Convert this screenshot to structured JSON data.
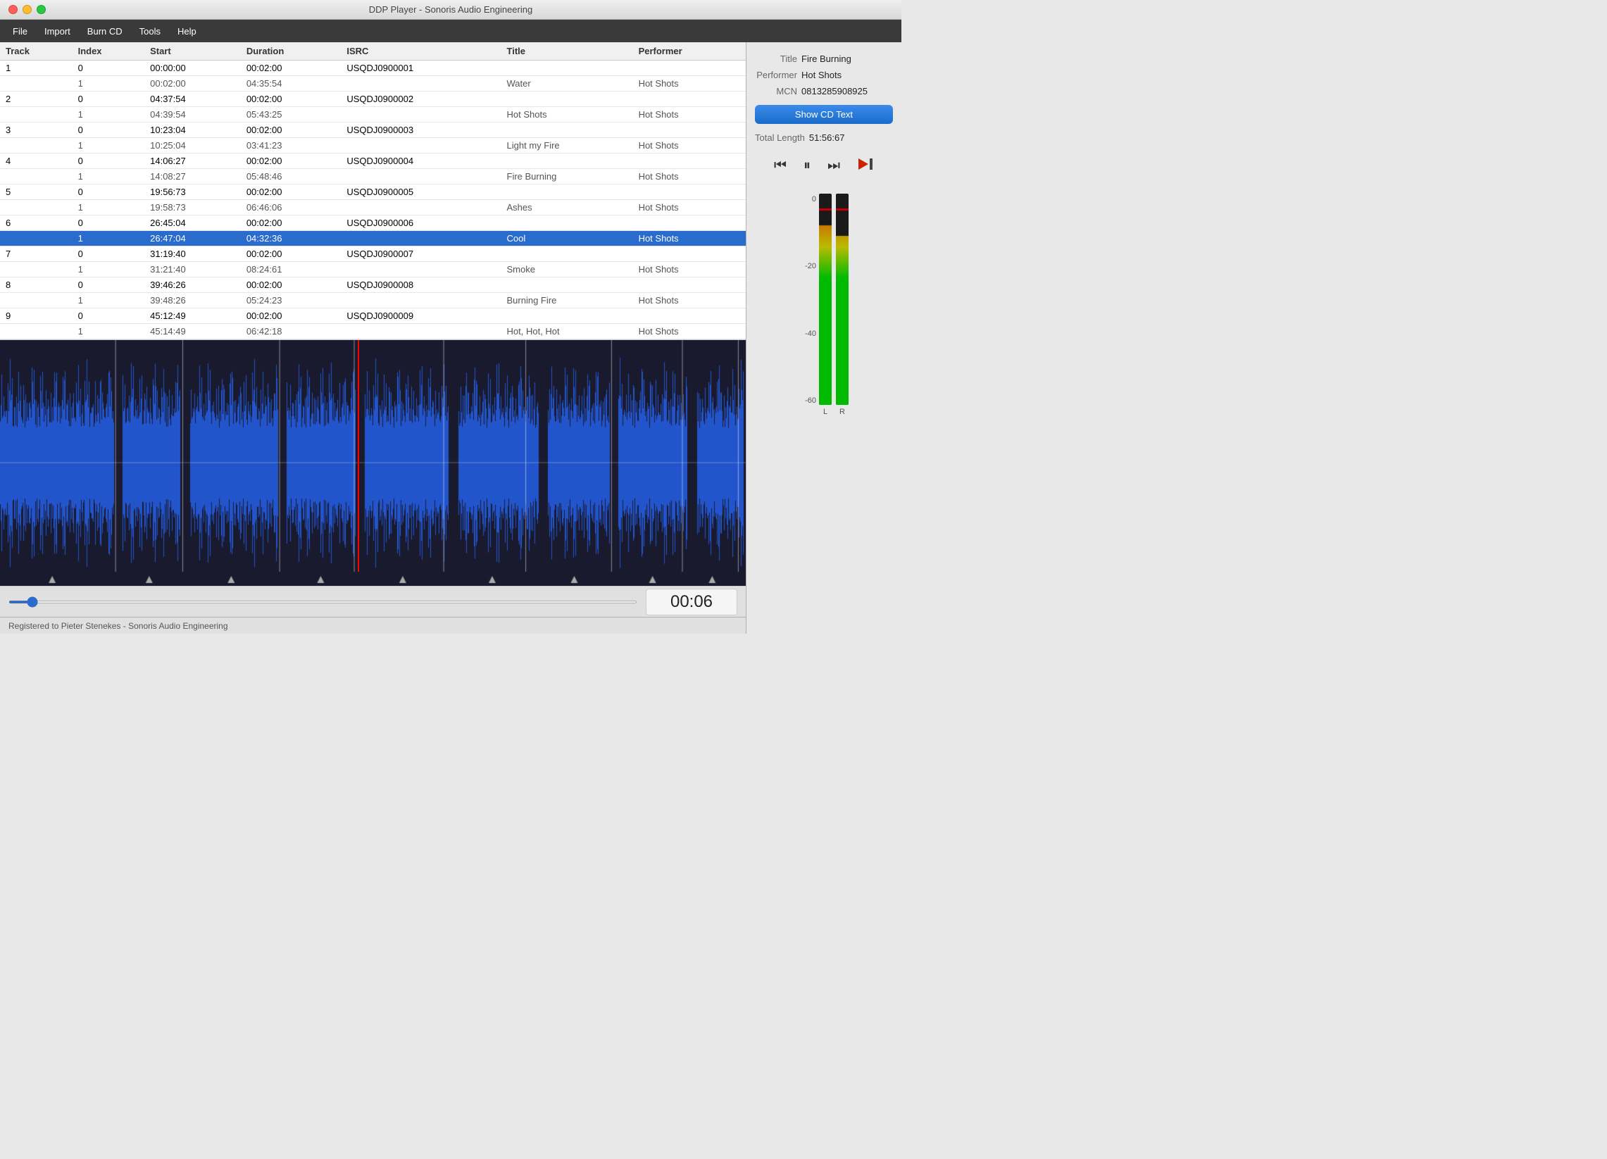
{
  "window": {
    "title": "DDP Player - Sonoris Audio Engineering"
  },
  "menu": {
    "items": [
      "File",
      "Import",
      "Burn CD",
      "Tools",
      "Help"
    ]
  },
  "table": {
    "columns": [
      "Track",
      "Index",
      "Start",
      "Duration",
      "ISRC",
      "Title",
      "Performer"
    ],
    "rows": [
      {
        "track": "1",
        "index": "0",
        "start": "00:00:00",
        "duration": "00:02:00",
        "isrc": "USQDJ0900001",
        "title": "",
        "performer": "",
        "selected": false,
        "isTrack": true
      },
      {
        "track": "",
        "index": "1",
        "start": "00:02:00",
        "duration": "04:35:54",
        "isrc": "",
        "title": "Water",
        "performer": "Hot Shots",
        "selected": false,
        "isTrack": false
      },
      {
        "track": "2",
        "index": "0",
        "start": "04:37:54",
        "duration": "00:02:00",
        "isrc": "USQDJ0900002",
        "title": "",
        "performer": "",
        "selected": false,
        "isTrack": true
      },
      {
        "track": "",
        "index": "1",
        "start": "04:39:54",
        "duration": "05:43:25",
        "isrc": "",
        "title": "Hot Shots",
        "performer": "Hot Shots",
        "selected": false,
        "isTrack": false
      },
      {
        "track": "3",
        "index": "0",
        "start": "10:23:04",
        "duration": "00:02:00",
        "isrc": "USQDJ0900003",
        "title": "",
        "performer": "",
        "selected": false,
        "isTrack": true
      },
      {
        "track": "",
        "index": "1",
        "start": "10:25:04",
        "duration": "03:41:23",
        "isrc": "",
        "title": "Light my Fire",
        "performer": "Hot Shots",
        "selected": false,
        "isTrack": false
      },
      {
        "track": "4",
        "index": "0",
        "start": "14:06:27",
        "duration": "00:02:00",
        "isrc": "USQDJ0900004",
        "title": "",
        "performer": "",
        "selected": false,
        "isTrack": true
      },
      {
        "track": "",
        "index": "1",
        "start": "14:08:27",
        "duration": "05:48:46",
        "isrc": "",
        "title": "Fire Burning",
        "performer": "Hot Shots",
        "selected": false,
        "isTrack": false
      },
      {
        "track": "5",
        "index": "0",
        "start": "19:56:73",
        "duration": "00:02:00",
        "isrc": "USQDJ0900005",
        "title": "",
        "performer": "",
        "selected": false,
        "isTrack": true
      },
      {
        "track": "",
        "index": "1",
        "start": "19:58:73",
        "duration": "06:46:06",
        "isrc": "",
        "title": "Ashes",
        "performer": "Hot Shots",
        "selected": false,
        "isTrack": false
      },
      {
        "track": "6",
        "index": "0",
        "start": "26:45:04",
        "duration": "00:02:00",
        "isrc": "USQDJ0900006",
        "title": "",
        "performer": "",
        "selected": false,
        "isTrack": true
      },
      {
        "track": "",
        "index": "1",
        "start": "26:47:04",
        "duration": "04:32:36",
        "isrc": "",
        "title": "Cool",
        "performer": "Hot Shots",
        "selected": true,
        "isTrack": false
      },
      {
        "track": "7",
        "index": "0",
        "start": "31:19:40",
        "duration": "00:02:00",
        "isrc": "USQDJ0900007",
        "title": "",
        "performer": "",
        "selected": false,
        "isTrack": true
      },
      {
        "track": "",
        "index": "1",
        "start": "31:21:40",
        "duration": "08:24:61",
        "isrc": "",
        "title": "Smoke",
        "performer": "Hot Shots",
        "selected": false,
        "isTrack": false
      },
      {
        "track": "8",
        "index": "0",
        "start": "39:46:26",
        "duration": "00:02:00",
        "isrc": "USQDJ0900008",
        "title": "",
        "performer": "",
        "selected": false,
        "isTrack": true
      },
      {
        "track": "",
        "index": "1",
        "start": "39:48:26",
        "duration": "05:24:23",
        "isrc": "",
        "title": "Burning Fire",
        "performer": "Hot Shots",
        "selected": false,
        "isTrack": false
      },
      {
        "track": "9",
        "index": "0",
        "start": "45:12:49",
        "duration": "00:02:00",
        "isrc": "USQDJ0900009",
        "title": "",
        "performer": "",
        "selected": false,
        "isTrack": true
      },
      {
        "track": "",
        "index": "1",
        "start": "45:14:49",
        "duration": "06:42:18",
        "isrc": "",
        "title": "Hot, Hot, Hot",
        "performer": "Hot Shots",
        "selected": false,
        "isTrack": false
      }
    ]
  },
  "info_panel": {
    "title_label": "Title",
    "title_value": "Fire Burning",
    "performer_label": "Performer",
    "performer_value": "Hot Shots",
    "mcn_label": "MCN",
    "mcn_value": "0813285908925",
    "show_cd_text_btn": "Show CD Text",
    "total_length_label": "Total Length",
    "total_length_value": "51:56:67"
  },
  "transport": {
    "rewind_icon": "⏮",
    "pause_icon": "⏸",
    "forward_icon": "⏭",
    "play_to_end_icon": "▶|"
  },
  "vu_meter": {
    "scale_labels": [
      "0",
      "-20",
      "-40",
      "-60"
    ],
    "channel_labels": [
      "L",
      "R"
    ],
    "left_level": 0.85,
    "right_level": 0.8
  },
  "playback": {
    "time_display": "00:06",
    "progress_value": "3"
  },
  "statusbar": {
    "text": "Registered to Pieter Stenekes - Sonoris Audio Engineering"
  }
}
